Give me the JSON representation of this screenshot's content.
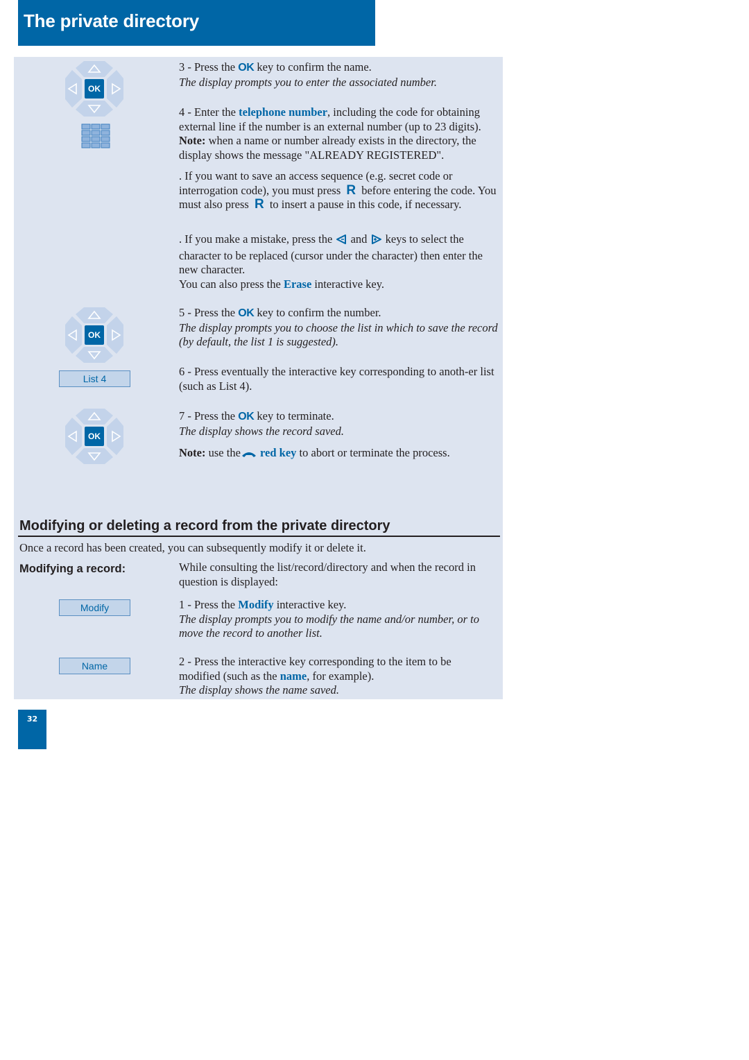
{
  "header": {
    "title": "The private directory"
  },
  "steps_top": {
    "step3": {
      "prefix": "3 - Press the ",
      "key": "OK",
      "suffix": " key to confirm the name.",
      "prompt": "The display prompts you to enter the associated number."
    },
    "step4": {
      "prefix": "4 - Enter the ",
      "keyword": "telephone number",
      "suffix": ", including the code for obtaining external line if the number is an external number (up to 23 digits).",
      "note_label": "Note:",
      "note_text": " when a name or number already exists in the directory, the display shows the message \"ALREADY REGISTERED\"."
    },
    "access": {
      "part1": ". If you want to save an access sequence (e.g. secret code or interrogation code), you must press ",
      "key1": "R",
      "part2": " before entering the code. You must also press ",
      "key2": "R",
      "part3": " to insert a pause in this code, if necessary."
    },
    "mistake": {
      "part1": ". If you make a mistake, press the ",
      "part2": " and ",
      "part3": " keys to select the character to be replaced (cursor under the character) then enter the new character.",
      "erase_prefix": "You can also press the ",
      "erase_keyword": "Erase",
      "erase_suffix": " interactive key."
    },
    "step5": {
      "prefix": "5 - Press the ",
      "key": "OK",
      "suffix": " key to confirm the number.",
      "prompt": "The display prompts you to choose the list in which to save the record (by default, the list 1 is suggested)."
    },
    "step6": {
      "text": "6 - Press eventually the interactive key corresponding to anoth-er list (such as List 4)."
    },
    "step7": {
      "prefix": "7 - Press the ",
      "key": "OK",
      "suffix": " key to terminate.",
      "prompt": "The display shows the record saved."
    },
    "note_red": {
      "label": "Note:",
      "prefix": " use the",
      "keyword": "red key",
      "suffix": " to abort or terminate the process."
    }
  },
  "navpad": {
    "ok_label": "OK"
  },
  "softkeys": {
    "list4": "List 4",
    "modify": "Modify",
    "name": "Name"
  },
  "section": {
    "title": "Modifying or deleting a record from the private directory",
    "intro": "Once a record has been created, you can subsequently modify it or delete it.",
    "sub_label": "Modifying a record:",
    "sub_intro": "While consulting the list/record/directory and when the record in question is displayed:",
    "step1": {
      "prefix": "1 - Press the ",
      "keyword": "Modify",
      "suffix": " interactive key.",
      "prompt": "The display prompts you to modify the name and/or number, or to move the record to another list."
    },
    "step2": {
      "prefix": "2 - Press the interactive key corresponding to the item to be modified (such as the ",
      "keyword": "name",
      "suffix": ", for example).",
      "prompt": "The display shows the name saved."
    }
  },
  "footer": {
    "page_number": "32"
  },
  "colors": {
    "brand_blue": "#0066a6",
    "panel_bg": "#dde4f0"
  }
}
